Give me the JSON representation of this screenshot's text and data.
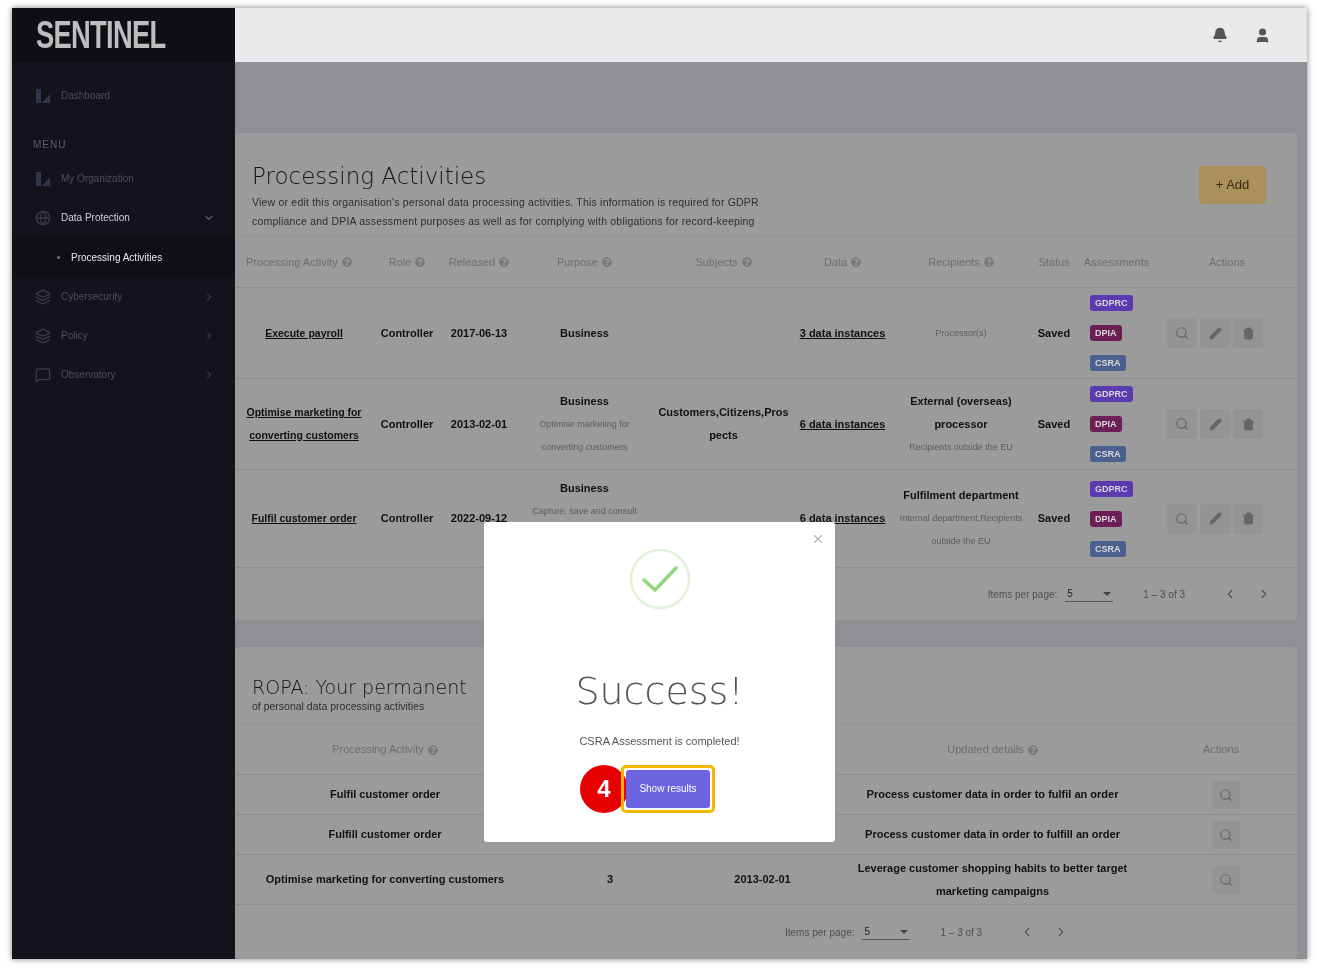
{
  "sidebar": {
    "logo": "SENTINEL",
    "items": [
      {
        "kind": "link",
        "label": "Dashboard",
        "selected": false
      },
      {
        "kind": "heading",
        "label": "MENU"
      },
      {
        "kind": "link",
        "label": "My Organization",
        "selected": false
      },
      {
        "kind": "group",
        "label": "Data Protection",
        "expanded": true
      },
      {
        "kind": "child",
        "label": "Processing Activities",
        "selected": true
      },
      {
        "kind": "group",
        "label": "Cybersecurity",
        "expanded": false
      },
      {
        "kind": "group",
        "label": "Policy",
        "expanded": false
      },
      {
        "kind": "group",
        "label": "Observatory",
        "expanded": false
      }
    ]
  },
  "activities": {
    "title": "Processing Activities",
    "description": "View or edit this organisation's personal data processing activities. This information is required for GDPR compliance and DPIA assessment purposes as well as for complying with obligations for record-keeping",
    "add_button": "+ Add",
    "columns": [
      {
        "label": "Processing Activity",
        "help": true
      },
      {
        "label": "Role",
        "help": true
      },
      {
        "label": "Released",
        "help": true
      },
      {
        "label": "Purpose",
        "help": true
      },
      {
        "label": "Subjects",
        "help": true
      },
      {
        "label": "Data",
        "help": true
      },
      {
        "label": "Recipients",
        "help": true
      },
      {
        "label": "Status",
        "help": false
      },
      {
        "label": "Assessments",
        "help": false
      },
      {
        "label": "Actions",
        "help": false
      }
    ],
    "rows": [
      {
        "activity": "Execute payroll",
        "role": "Controller",
        "released": "2017-06-13",
        "purpose": "Business",
        "data": "3 data instances",
        "recipients_note": "Processor(s)",
        "status": "Saved",
        "assessments": [
          {
            "label": "GDPRC",
            "color": "#5a3bb0"
          },
          {
            "label": "DPIA",
            "color": "#6b1f55"
          },
          {
            "label": "CSRA",
            "color": "#4a6190"
          }
        ]
      },
      {
        "activity": "Optimise marketing for converting customers",
        "role": "Controller",
        "released": "2013-02-01",
        "purpose": "Business",
        "purpose_note": "Optimise marketing for converting customers",
        "subjects": "Customers,Citizens,Prospects",
        "data": "6 data instances",
        "recipients": "External (overseas) processor",
        "recipients_note": "Recipients outside the EU",
        "status": "Saved",
        "assessments": [
          {
            "label": "GDPRC",
            "color": "#5a3bb0"
          },
          {
            "label": "DPIA",
            "color": "#6b1f55"
          },
          {
            "label": "CSRA",
            "color": "#4a6190"
          }
        ]
      },
      {
        "activity": "Fulfil customer order",
        "role": "Controller",
        "released": "2022-09-12",
        "purpose": "Business",
        "purpose_note": "Capture, save and consult",
        "data": "6 data instances",
        "recipients": "Fulfilment department",
        "recipients_note": "Internal department,Recipients outside the EU",
        "status": "Saved",
        "assessments": [
          {
            "label": "GDPRC",
            "color": "#5a3bb0"
          },
          {
            "label": "DPIA",
            "color": "#6b1f55"
          },
          {
            "label": "CSRA",
            "color": "#4a6190"
          }
        ]
      }
    ],
    "pagination": {
      "label": "Items per page:",
      "value": "5",
      "range": "1 – 3 of 3"
    }
  },
  "ropa": {
    "title": "ROPA: Your permanent",
    "subtitle": "of personal data processing activities",
    "columns": [
      {
        "label": "Processing Activity",
        "help": true
      },
      {},
      {},
      {
        "label": "Updated details",
        "help": true
      },
      {
        "label": "Actions",
        "help": false
      }
    ],
    "rows": [
      {
        "activity": "Fulfil customer order",
        "details": "Process customer data in order to fulfil an order"
      },
      {
        "activity": "Fulfill customer order",
        "details": "Process customer data in order to fulfill an order"
      },
      {
        "activity": "Optimise marketing for converting customers",
        "column_2": "3",
        "column_3": "2013-02-01",
        "details": "Leverage customer shopping habits to better target marketing campaigns"
      }
    ],
    "pagination": {
      "label": "Items per page:",
      "value": "5",
      "range": "1 – 3 of 3"
    }
  },
  "modal": {
    "title": "Success!",
    "message": "CSRA Assessment is completed!",
    "button": "Show results",
    "step": "4"
  }
}
